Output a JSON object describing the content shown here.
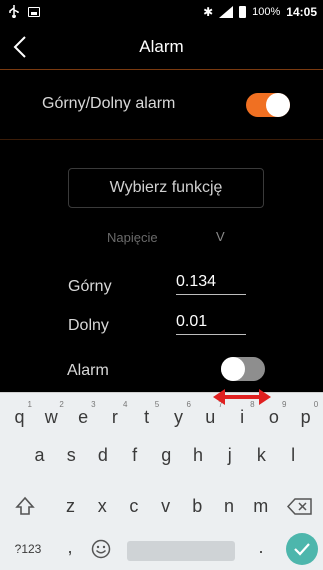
{
  "statusbar": {
    "battery_pct": "100%",
    "time": "14:05",
    "icons": [
      "usb-icon",
      "image-icon",
      "bluetooth-icon",
      "signal-4g-icon",
      "battery-icon"
    ]
  },
  "appbar": {
    "title": "Alarm",
    "back_icon": "chevron-left-icon"
  },
  "alarm_row": {
    "label": "Górny/Dolny alarm",
    "toggle_on": true
  },
  "function_button": {
    "label": "Wybierz funkcję"
  },
  "measurement": {
    "name": "Napięcie",
    "unit": "V"
  },
  "upper": {
    "label": "Górny",
    "value": "0.134"
  },
  "lower": {
    "label": "Dolny",
    "value": "0.01"
  },
  "alarm": {
    "label": "Alarm",
    "toggle_on": false
  },
  "keyboard": {
    "row1": [
      {
        "key": "q",
        "hint": "1"
      },
      {
        "key": "w",
        "hint": "2"
      },
      {
        "key": "e",
        "hint": "3"
      },
      {
        "key": "r",
        "hint": "4"
      },
      {
        "key": "t",
        "hint": "5"
      },
      {
        "key": "y",
        "hint": "6"
      },
      {
        "key": "u",
        "hint": "7"
      },
      {
        "key": "i",
        "hint": "8"
      },
      {
        "key": "o",
        "hint": "9"
      },
      {
        "key": "p",
        "hint": "0"
      }
    ],
    "row2": [
      "a",
      "s",
      "d",
      "f",
      "g",
      "h",
      "j",
      "k",
      "l"
    ],
    "row3": [
      "z",
      "x",
      "c",
      "v",
      "b",
      "n",
      "m"
    ],
    "symbols_label": "?123",
    "comma": ",",
    "period": ".",
    "icons": [
      "shift-icon",
      "backspace-icon",
      "emoji-icon",
      "enter-check-icon"
    ]
  },
  "colors": {
    "accent": "#f07022",
    "toggle_off": "#8e8e8e",
    "enter_key": "#4db6ac",
    "annotation_arrow": "#e02020"
  }
}
